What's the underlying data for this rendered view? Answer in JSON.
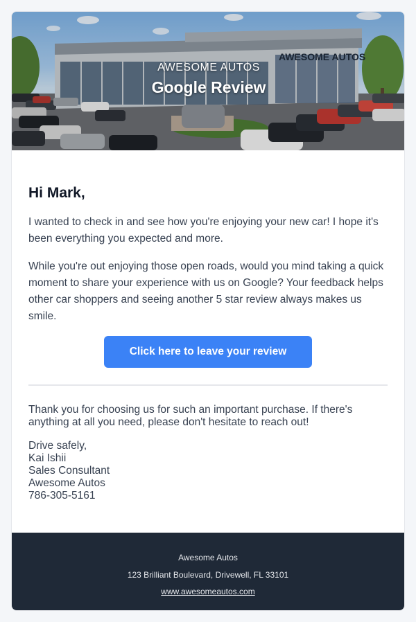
{
  "hero": {
    "brand": "AWESOME AUTOS",
    "title": "Google Review",
    "building_sign": "AWESOME AUTOS"
  },
  "email": {
    "greeting": "Hi Mark,",
    "paragraph1": "I wanted to check in and see how you're enjoying your new car! I hope it's been everything you expected and more.",
    "paragraph2": "While you're out enjoying those open roads, would you mind taking a quick moment to share your experience with us on Google? Your feedback helps other car shoppers and seeing another 5 star review always makes us smile.",
    "cta_label": "Click here to leave your review",
    "thanks": "Thank you for choosing us for such an important purchase. If there's anything at all you need, please don't hesitate to reach out!",
    "signature": {
      "closing": "Drive safely,",
      "name": "Kai Ishii",
      "title": "Sales Consultant",
      "company": "Awesome Autos",
      "phone": "786-305-5161"
    }
  },
  "footer": {
    "company": "Awesome Autos",
    "address": "123 Brilliant Boulevard, Drivewell, FL 33101",
    "website": "www.awesomeautos.com"
  },
  "colors": {
    "accent": "#3b82f6",
    "footer_bg": "#1f2937",
    "page_bg": "#f4f6f9"
  }
}
